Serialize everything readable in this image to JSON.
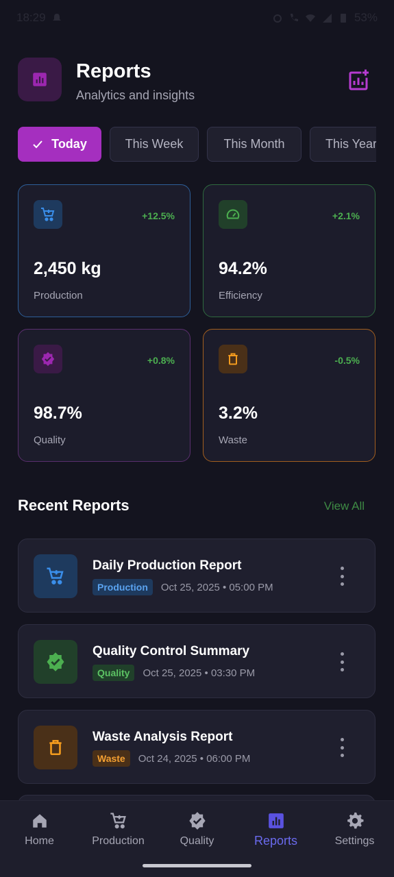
{
  "status_bar": {
    "time": "18:29",
    "battery": "53%"
  },
  "header": {
    "title": "Reports",
    "subtitle": "Analytics and insights",
    "icons": {
      "app": "bar-chart-icon",
      "add": "add-chart-icon"
    }
  },
  "filters": [
    {
      "label": "Today",
      "active": true
    },
    {
      "label": "This Week",
      "active": false
    },
    {
      "label": "This Month",
      "active": false
    },
    {
      "label": "This Year",
      "active": false
    }
  ],
  "stats": [
    {
      "change": "+12.5%",
      "value": "2,450 kg",
      "label": "Production",
      "icon": "cart-icon",
      "color": "#3a8eea"
    },
    {
      "change": "+2.1%",
      "value": "94.2%",
      "label": "Efficiency",
      "icon": "speedometer-icon",
      "color": "#4caf50"
    },
    {
      "change": "+0.8%",
      "value": "98.7%",
      "label": "Quality",
      "icon": "verified-badge-icon",
      "color": "#9c27b0"
    },
    {
      "change": "-0.5%",
      "value": "3.2%",
      "label": "Waste",
      "icon": "trash-icon",
      "color": "#f39b1e"
    }
  ],
  "recent": {
    "title": "Recent Reports",
    "view_all": "View All",
    "items": [
      {
        "title": "Daily Production Report",
        "badge": "Production",
        "date": "Oct 25, 2025 • 05:00 PM",
        "icon": "cart-icon"
      },
      {
        "title": "Quality Control Summary",
        "badge": "Quality",
        "date": "Oct 25, 2025 • 03:30 PM",
        "icon": "verified-badge-icon"
      },
      {
        "title": "Waste Analysis Report",
        "badge": "Waste",
        "date": "Oct 24, 2025 • 06:00 PM",
        "icon": "trash-icon"
      }
    ]
  },
  "nav": [
    {
      "label": "Home",
      "icon": "home-icon",
      "active": false
    },
    {
      "label": "Production",
      "icon": "cart-icon",
      "active": false
    },
    {
      "label": "Quality",
      "icon": "verified-badge-icon",
      "active": false
    },
    {
      "label": "Reports",
      "icon": "bar-chart-icon",
      "active": true
    },
    {
      "label": "Settings",
      "icon": "gear-icon",
      "active": false
    }
  ],
  "colors": {
    "accent": "#a52fbf",
    "nav_active": "#6a6aee",
    "positive": "#4caf50"
  }
}
